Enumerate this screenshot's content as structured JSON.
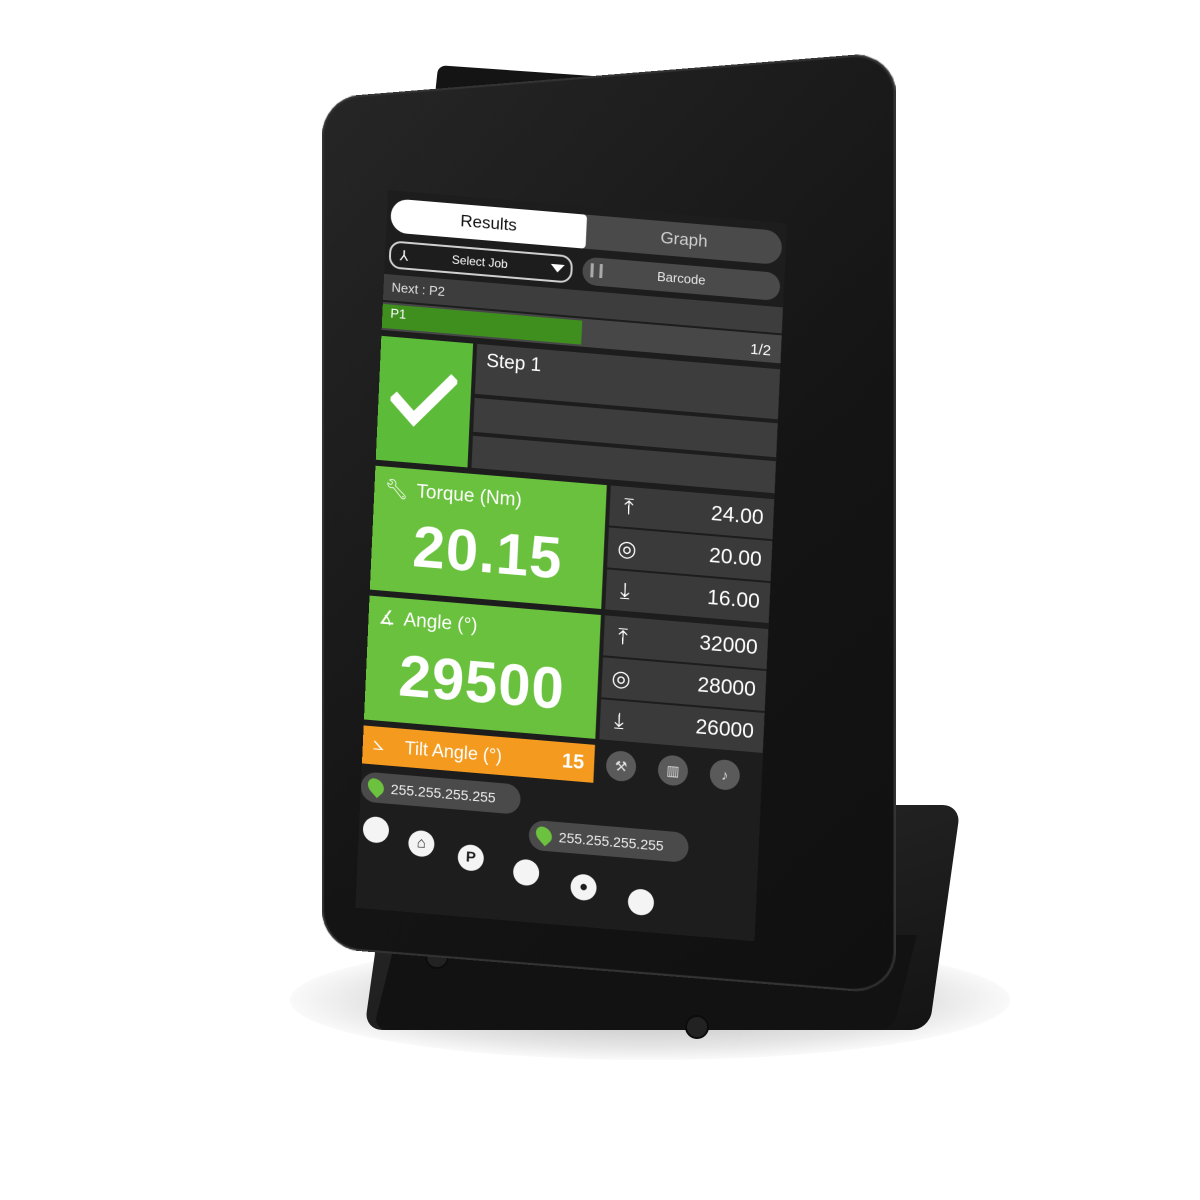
{
  "tabs": {
    "results": "Results",
    "graph": "Graph"
  },
  "toolbar": {
    "select_job": "Select Job",
    "barcode": "Barcode"
  },
  "job": {
    "next": "Next : P2",
    "current": "P1",
    "counter": "1/2",
    "progress": 0.5
  },
  "step": {
    "label": "Step 1",
    "status": "ok"
  },
  "torque": {
    "label": "Torque (Nm)",
    "value": "20.15",
    "max": "24.00",
    "target": "20.00",
    "min": "16.00"
  },
  "angle": {
    "label": "Angle (°)",
    "value": "29500",
    "max": "32000",
    "target": "28000",
    "min": "26000"
  },
  "tilt": {
    "label": "Tilt Angle (°)",
    "value": "15"
  },
  "network": {
    "ip1": "255.255.255.255",
    "ip2": "255.255.255.255"
  },
  "colors": {
    "ok_green": "#69c13d",
    "progress_green": "#3f8f1f",
    "tilt_orange": "#f39a1f",
    "panel": "#3a3a3a"
  },
  "icons": {
    "torque": "wrench-icon",
    "angle": "angle-icon",
    "tilt": "tilt-icon",
    "max": "arrow-up-icon",
    "target": "target-icon",
    "min": "arrow-down-icon"
  }
}
